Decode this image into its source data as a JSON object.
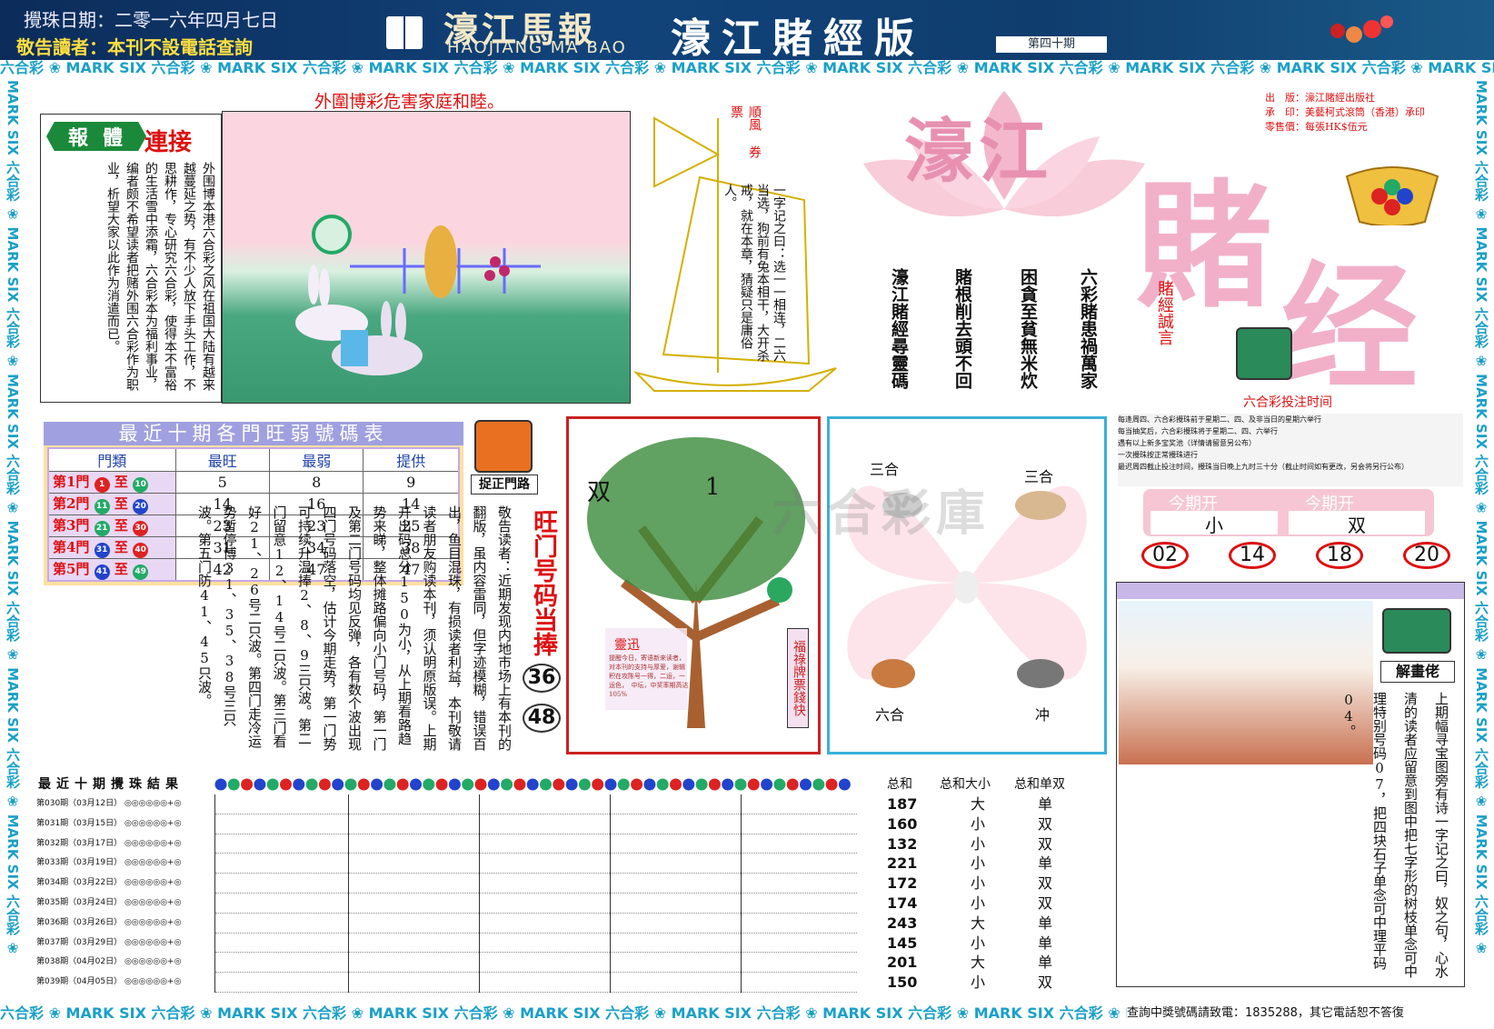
{
  "header": {
    "date": "攪珠日期：二零一六年四月七日",
    "notice_prefix": "敬告讀者：",
    "notice_text": "本刊不設電話查詢",
    "logo_cn": "濠江馬報",
    "logo_en": "HAOJIANG MA BAO",
    "title": "濠江賭經版",
    "issue": "第四十期"
  },
  "band_text": "六合彩 ❀ MARK SIX 六合彩 ❀ MARK SIX 六合彩 ❀ MARK SIX 六合彩 ❀ MARK SIX 六合彩 ❀ MARK SIX 六合彩 ❀ MARK SIX 六合彩 ❀ MARK SIX 六合彩 ❀ MARK SIX 六合彩 ❀ MARK SIX 六合彩 ❀ MARK SIX",
  "side_band_text": "MARK SIX 六合彩 ❀ MARK SIX 六合彩 ❀ MARK SIX 六合彩 ❀ MARK SIX 六合彩 ❀ MARK SIX 六合彩 ❀ MARK SIX 六合彩 ❀",
  "slogan": "外圍博彩危害家庭和睦。",
  "article": {
    "tag1": "報",
    "tag2": "體",
    "tag3": "連接",
    "body": "外围博本港六合彩之风在祖国大陆有越来越蔓延之势，有不少人放下手头工作，不思耕作，专心研究六合彩，使得本不富裕的生活雪中添霜，六合彩本为福利事业，编者颇不希望读者把赌外围六合彩作为职业，析望大家以此作为消遣而已。"
  },
  "boat": {
    "flag": "順風 券票",
    "riddle": "一字记之曰：选一一相连，二六当选，狗前有兔本相干，大开杀戒，就在本章，猜疑只是庸俗人。"
  },
  "lotus": {
    "big1": "濠江",
    "big2": "賭",
    "big3": "经",
    "motto_label": "賭經誠言",
    "poem": [
      "六彩賭患禍萬家",
      "困貪至貧無米炊",
      "賭根削去頭不回",
      "濠江賭經尋靈碼"
    ]
  },
  "publisher": {
    "l1": "出　版：濠江賭經出版社",
    "l2": "承　印：美藝柯式滾筒（香港）承印",
    "l3": "零售價：每張HK$伍元"
  },
  "stats_table": {
    "title": "最近十期各門旺弱號碼表",
    "headers": [
      "門類",
      "最旺",
      "最弱",
      "提供"
    ],
    "rows": [
      {
        "name": "第1門",
        "a": "1",
        "b": "10",
        "c1": "#d22",
        "c2": "#2a6",
        "max": "5",
        "min": "8",
        "give": "9"
      },
      {
        "name": "第2門",
        "a": "11",
        "b": "20",
        "c1": "#2a6",
        "c2": "#24c",
        "max": "14",
        "min": "16",
        "give": "14"
      },
      {
        "name": "第3門",
        "a": "21",
        "b": "30",
        "c1": "#2a6",
        "c2": "#d22",
        "max": "23",
        "min": "23",
        "give": "25"
      },
      {
        "name": "第4門",
        "a": "31",
        "b": "40",
        "c1": "#24c",
        "c2": "#d22",
        "max": "31",
        "min": "34",
        "give": "38"
      },
      {
        "name": "第5門",
        "a": "41",
        "b": "49",
        "c1": "#24c",
        "c2": "#2a6",
        "max": "42",
        "min": "47",
        "give": "47"
      }
    ]
  },
  "catch_label": "捉正門路",
  "door_text": "敬告读者：近期发现内地市场上有本刊的翻版，虽内容雷同，但字迹模糊，错误百出，鱼目混珠，有损读者利益，本刊敬请读者朋友购读本刊，须认明原版误。上期开出码总分150为小，从上期看路趋势来睇，整体摊路偏向小门号码，第一门及第二门号码均见反弹，各有数个波出现四门号码落空，估计今期走势，第一门势可持续升温捧2、8、9三只波。第二门留意12、14号二只波。第三门看好21、26号二只波。第四门走冷运势暂停博31、35、38号三只波。第五门防41、45只波。",
  "wang_label": "旺门号码当捧",
  "wang_nums": [
    "36",
    "48"
  ],
  "tree": {
    "left_char": "双",
    "right_char": "1",
    "tip_title": "靈迅",
    "tip_text": "提醒今日，寄语新来读者，对本刊的支持与厚爱，谢辑积在攻陈号一得，二运，一运色，　中坛，中奖率期高达105%",
    "side_label": "福祿牌票錢快"
  },
  "zodiac": {
    "top_left": "三合",
    "top_right": "三合",
    "bottom_left": "六合",
    "bottom_right": "冲"
  },
  "right_panel": {
    "timing_title": "六合彩投注时间",
    "rules": [
      "每逢周四、六合彩攪珠前于星期二、四、及非当日的星期六举行",
      "每当抽奖后，六合彩攪珠将于星期二、四、六举行",
      "遇有以上新多宝奖池（详情请留意另公布）",
      "一次攪珠按正常攪珠进行",
      "最迟周四截止投注时间，攪珠当日晚上九时三十分（截止时间如有更改，另会将另行公布）"
    ],
    "open1_label": "今期开",
    "open1_value": "小",
    "open2_label": "今期开",
    "open2_value": "双",
    "balls": [
      "02",
      "14",
      "18",
      "20"
    ]
  },
  "riddle_panel": {
    "label": "解畫佬",
    "text": "上期幅寻宝图旁有诗一字记之曰，奴之句，心水清的读者应留意到图中把七字形的树枝单念可中理特别号码07，把四块石子单念可中理平码04。"
  },
  "results": {
    "title": "最近十期攪珠結果",
    "rows": [
      {
        "issue": "第030期（03月12日）",
        "sum": "187",
        "size": "大",
        "parity": "单"
      },
      {
        "issue": "第031期（03月15日）",
        "sum": "160",
        "size": "小",
        "parity": "双"
      },
      {
        "issue": "第032期（03月17日）",
        "sum": "132",
        "size": "小",
        "parity": "双"
      },
      {
        "issue": "第033期（03月19日）",
        "sum": "221",
        "size": "小",
        "parity": "单"
      },
      {
        "issue": "第034期（03月22日）",
        "sum": "172",
        "size": "小",
        "parity": "双"
      },
      {
        "issue": "第035期（03月24日）",
        "sum": "174",
        "size": "小",
        "parity": "双"
      },
      {
        "issue": "第036期（03月26日）",
        "sum": "243",
        "size": "大",
        "parity": "单"
      },
      {
        "issue": "第037期（03月29日）",
        "sum": "145",
        "size": "小",
        "parity": "单"
      },
      {
        "issue": "第038期（04月02日）",
        "sum": "201",
        "size": "大",
        "parity": "单"
      },
      {
        "issue": "第039期（04月05日）",
        "sum": "150",
        "size": "小",
        "parity": "双"
      }
    ],
    "col_sum": "总和",
    "col_size": "总和大小",
    "col_parity": "总和单双"
  },
  "footer": {
    "contact": "查詢中獎號碼請致電：1835288，其它電話恕不答復"
  },
  "watermark": "六合彩庫"
}
